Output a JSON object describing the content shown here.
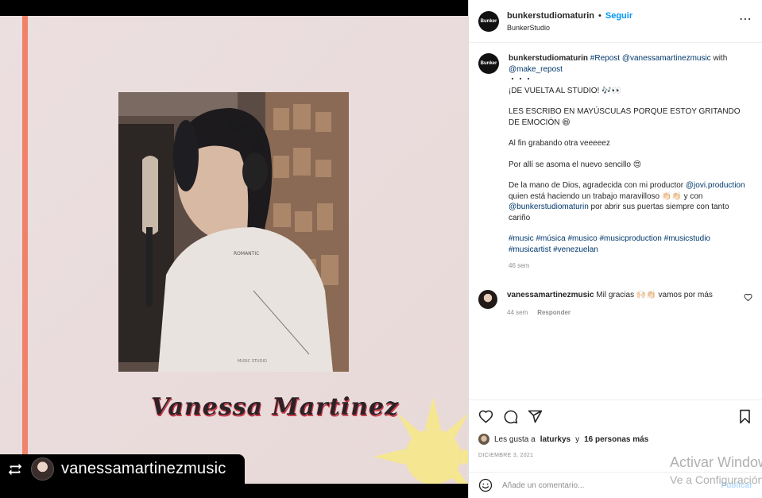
{
  "media": {
    "signature": "Vanessa Martinez",
    "repost_username": "vanessamartinezmusic",
    "colors": {
      "stripe": "#f0826b",
      "background": "#ecdfe0",
      "sun": "#f7e88a"
    }
  },
  "header": {
    "avatar_text": "Bunker",
    "username": "bunkerstudiomaturin",
    "separator": "•",
    "follow_label": "Seguir",
    "location": "BunkerStudio",
    "more_icon": "⋯"
  },
  "caption": {
    "avatar_text": "Bunker",
    "username": "bunkerstudiomaturin",
    "repost_tag": "#Repost",
    "mention_artist": "@vanessamartinezmusic",
    "with_text": "with",
    "mention_tool": "@make_repost",
    "dots": "・・・",
    "line1": "¡DE VUELTA AL STUDIO! 🎶👀",
    "line2": "LES ESCRIBO EN MAYÚSCULAS PORQUE ESTOY GRITANDO DE EMOCIÓN 😆",
    "line3": "Al fin grabando otra veeeeez",
    "line4": "Por allí se asoma el nuevo sencillo 😍",
    "line5_a": "De la mano de Dios, agradecida con mi productor",
    "line5_mention": "@jovi.production",
    "line5_b": "quien está haciendo un trabajo maravilloso 👏🏻👏🏻 y con",
    "line5_mention2": "@bunkerstudiomaturin",
    "line5_c": "por abrir sus puertas siempre con tanto cariño",
    "hashtags": "#music #música #musico #musicproduction #musicstudio #musicartist #venezuelan",
    "time": "46 sem"
  },
  "reply": {
    "username": "vanessamartinezmusic",
    "text": "Mil gracias 🙌🏻👏🏻 vamos por más",
    "time": "44 sem",
    "reply_label": "Responder"
  },
  "actions": {
    "likes_text": "Les gusta a",
    "likes_user": "laturkys",
    "likes_rest": "y",
    "likes_count": "16 personas más",
    "date": "DICIEMBRE 3, 2021"
  },
  "add_comment": {
    "placeholder": "Añade un comentario...",
    "publish_label": "Publicar"
  },
  "watermark": {
    "line1": "Activar Windows",
    "line2": "Ve a Configuración"
  }
}
